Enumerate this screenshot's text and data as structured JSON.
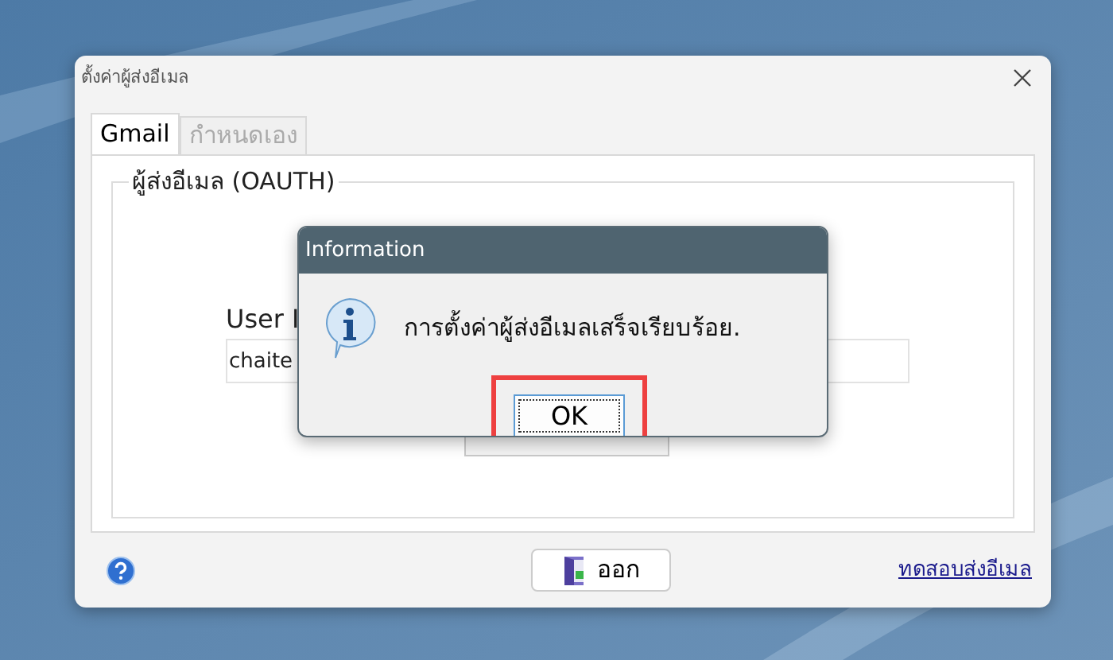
{
  "window": {
    "title": "ตั้งค่าผู้ส่งอีเมล"
  },
  "tabs": [
    {
      "label": "Gmail",
      "selected": true
    },
    {
      "label": "กำหนดเอง",
      "selected": false
    }
  ],
  "group": {
    "title": "ผู้ส่งอีเมล (OAUTH)",
    "field_label": "User I",
    "field_value": "chaite"
  },
  "footer": {
    "exit_button": "ออก",
    "test_link": "ทดสอบส่งอีเมล"
  },
  "dialog": {
    "title": "Information",
    "message": "การตั้งค่าผู้ส่งอีเมลเสร็จเรียบร้อย.",
    "button": "OK",
    "button_highlighted": true
  }
}
